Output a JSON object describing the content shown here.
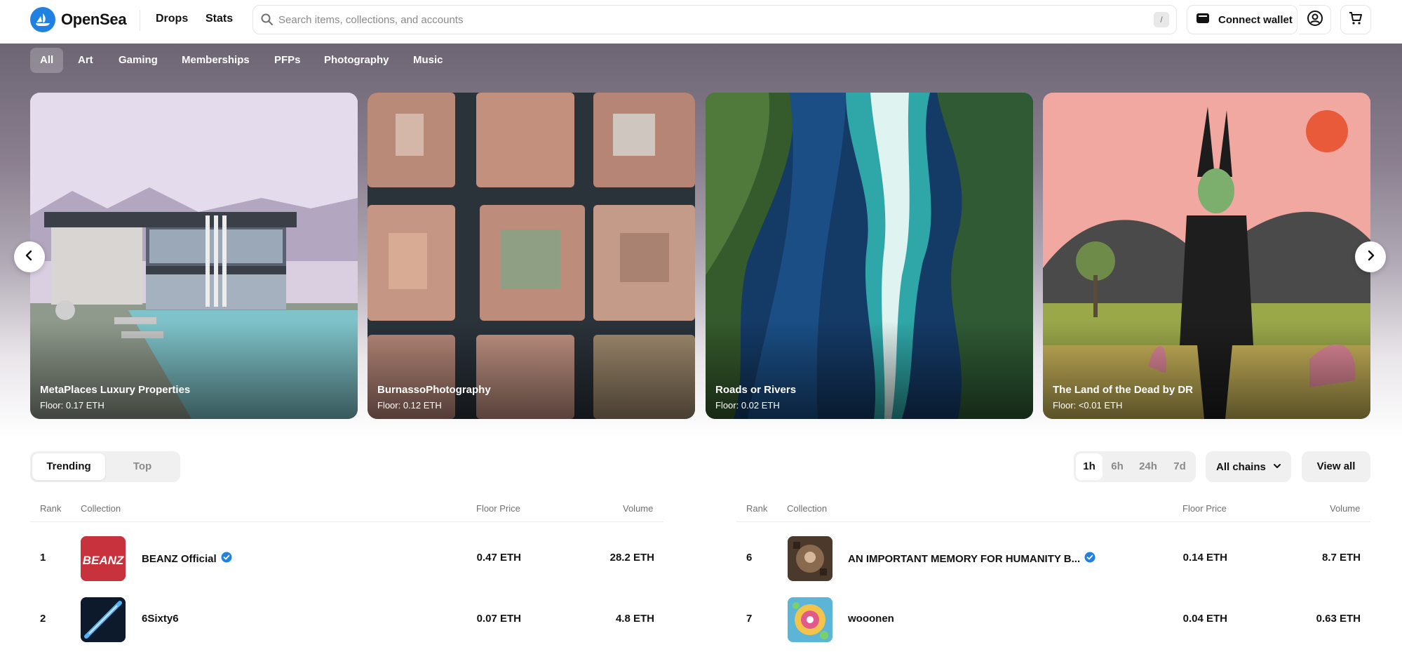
{
  "header": {
    "brand": "OpenSea",
    "nav": {
      "drops": "Drops",
      "stats": "Stats"
    },
    "search": {
      "placeholder": "Search items, collections, and accounts",
      "value": "",
      "shortcut": "/"
    },
    "connect_wallet": "Connect wallet",
    "icons": {
      "logo": "opensea-logo-icon",
      "search": "search-icon",
      "wallet": "wallet-icon",
      "profile": "profile-icon",
      "cart": "cart-icon"
    },
    "brand_color": "#2081e2"
  },
  "categories": [
    "All",
    "Art",
    "Gaming",
    "Memberships",
    "PFPs",
    "Photography",
    "Music"
  ],
  "active_category": "All",
  "featured": [
    {
      "title": "MetaPlaces Luxury Properties",
      "floor": "Floor: 0.17 ETH"
    },
    {
      "title": "BurnassoPhotography",
      "floor": "Floor: 0.12 ETH"
    },
    {
      "title": "Roads or Rivers",
      "floor": "Floor: 0.02 ETH"
    },
    {
      "title": "The Land of the Dead by DR",
      "floor": "Floor: <0.01 ETH"
    }
  ],
  "stats": {
    "tabs": {
      "trending": "Trending",
      "top": "Top"
    },
    "active_tab": "Trending",
    "time_ranges": [
      "1h",
      "6h",
      "24h",
      "7d"
    ],
    "active_range": "1h",
    "chains": "All chains",
    "view_all": "View all",
    "columns": {
      "rank": "Rank",
      "collection": "Collection",
      "floor": "Floor Price",
      "volume": "Volume"
    },
    "left_rows": [
      {
        "rank": "1",
        "name": "BEANZ Official",
        "verified": true,
        "floor": "0.47 ETH",
        "volume": "28.2 ETH",
        "thumb_text": "BEANZ"
      },
      {
        "rank": "2",
        "name": "6Sixty6",
        "verified": false,
        "floor": "0.07 ETH",
        "volume": "4.8 ETH",
        "thumb_text": ""
      }
    ],
    "right_rows": [
      {
        "rank": "6",
        "name": "AN IMPORTANT MEMORY FOR HUMANITY B...",
        "verified": true,
        "floor": "0.14 ETH",
        "volume": "8.7 ETH",
        "thumb_text": ""
      },
      {
        "rank": "7",
        "name": "wooonen",
        "verified": false,
        "floor": "0.04 ETH",
        "volume": "0.63 ETH",
        "thumb_text": ""
      }
    ],
    "verified_color": "#2081e2"
  }
}
